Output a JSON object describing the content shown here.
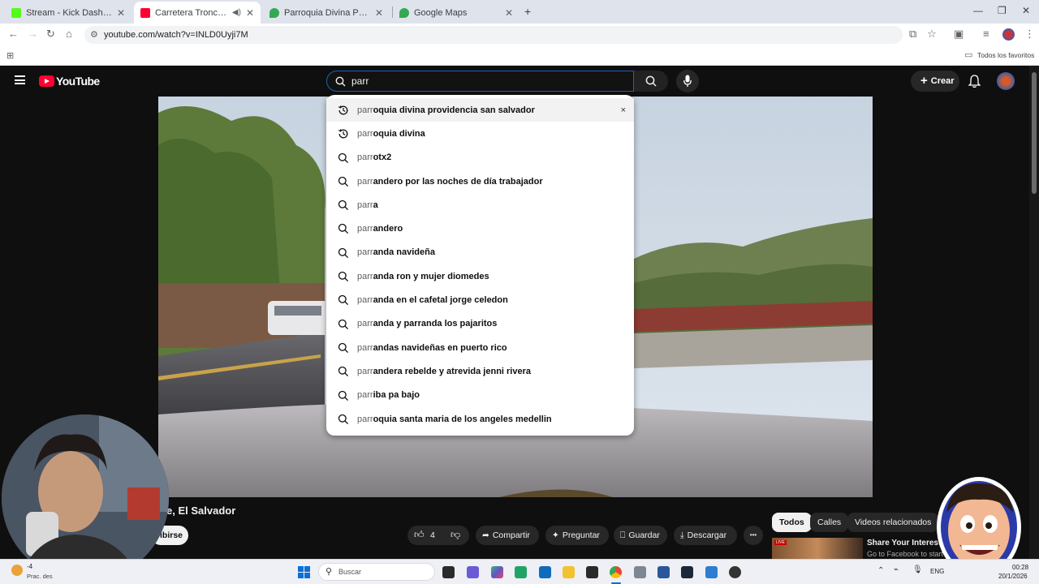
{
  "browser": {
    "tabs": [
      {
        "title": "Stream - Kick Dashboard",
        "favicon_color": "#53fc18",
        "active": false
      },
      {
        "title": "Carretera Troncal del Norte",
        "favicon_color": "#ff0033",
        "active": true
      },
      {
        "title": "Parroquia Divina Providencia - ",
        "favicon_color": "#34a853",
        "active": false
      },
      {
        "title": "Google Maps",
        "favicon_color": "#34a853",
        "active": false
      }
    ],
    "new_tab": "+",
    "url": "youtube.com/watch?v=INLD0Uyji7M",
    "bookmarks_all": "Todos los favoritos"
  },
  "youtube": {
    "logo_text": "YouTube",
    "search_value": "parr",
    "create_label": "Crear",
    "typed_prefix": "parr",
    "suggestions": [
      {
        "rest": "oquia divina providencia san salvador",
        "type": "history"
      },
      {
        "rest": "oquia divina",
        "type": "history"
      },
      {
        "rest": "otx2",
        "type": "search"
      },
      {
        "rest": "andero por las noches de día trabajador",
        "type": "search"
      },
      {
        "rest": "a",
        "type": "search"
      },
      {
        "rest": "andero",
        "type": "search"
      },
      {
        "rest": "anda navideña",
        "type": "search"
      },
      {
        "rest": "anda ron y mujer diomedes",
        "type": "search"
      },
      {
        "rest": "anda en el cafetal jorge celedon",
        "type": "search"
      },
      {
        "rest": "anda y parranda los pajaritos",
        "type": "search"
      },
      {
        "rest": "andas navideñas en puerto rico",
        "type": "search"
      },
      {
        "rest": "andera rebelde y atrevida jenni rivera",
        "type": "search"
      },
      {
        "rest": "iba pa bajo",
        "type": "search"
      },
      {
        "rest": "oquia santa maria de los angeles medellin",
        "type": "search"
      }
    ],
    "remove_label": "×",
    "video_title_visible": "e, El Salvador",
    "subscribe_visible": "ibirse",
    "like_count": "4",
    "actions": {
      "share": "Compartir",
      "ask": "Preguntar",
      "save": "Guardar",
      "download": "Descargar",
      "more": "•••"
    },
    "chips": [
      "Todos",
      "Calles",
      "Videos relacionados"
    ],
    "ad": {
      "title": "Share Your Interests o",
      "subtitle": "Go to Facebook to start us"
    }
  },
  "taskbar": {
    "weather_temp": "-4",
    "weather_text": "Prac. des",
    "search_placeholder": "Buscar",
    "lang": "ENG",
    "time": "00:28",
    "date": "20/1/2026"
  }
}
